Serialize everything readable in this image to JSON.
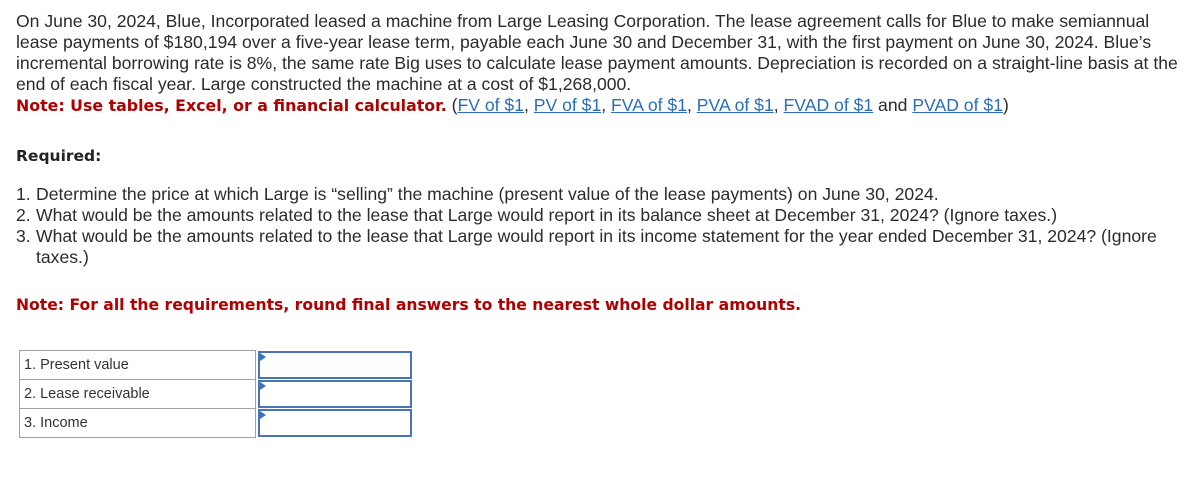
{
  "intro": {
    "text": "On June 30, 2024, Blue, Incorporated leased a machine from Large Leasing Corporation. The lease agreement calls for Blue to make semiannual lease payments of $180,194 over a five-year lease term, payable each June 30 and December 31, with the first payment on June 30, 2024. Blue’s incremental borrowing rate is 8%, the same rate Big uses to calculate lease payment amounts. Depreciation is recorded on a straight-line basis at the end of each fiscal year. Large constructed the machine at a cost of $1,268,000.",
    "note": "Note: Use tables, Excel, or a financial calculator.",
    "links_open": " (",
    "links": [
      {
        "label": "FV of $1",
        "sep": ", "
      },
      {
        "label": "PV of $1",
        "sep": ", "
      },
      {
        "label": "FVA of $1",
        "sep": ", "
      },
      {
        "label": "PVA of $1",
        "sep": ", "
      },
      {
        "label": "FVAD of $1",
        "sep": " and "
      },
      {
        "label": "PVAD of $1",
        "sep": ")"
      }
    ]
  },
  "required": {
    "heading": "Required:",
    "items": [
      {
        "num": "1.",
        "text": "Determine the price at which Large is “selling” the machine (present value of the lease payments) on June 30, 2024."
      },
      {
        "num": "2.",
        "text": "What would be the amounts related to the lease that Large would report in its balance sheet at December 31, 2024? (Ignore taxes.)"
      },
      {
        "num": "3.",
        "text": "What would be the amounts related to the lease that Large would report in its income statement for the year ended December 31, 2024? (Ignore taxes.)"
      }
    ],
    "note": "Note: For all the requirements, round final answers to the nearest whole dollar amounts."
  },
  "answer_table": {
    "rows": [
      {
        "label": "1. Present value",
        "value": ""
      },
      {
        "label": "2. Lease receivable",
        "value": ""
      },
      {
        "label": "3. Income",
        "value": ""
      }
    ]
  }
}
